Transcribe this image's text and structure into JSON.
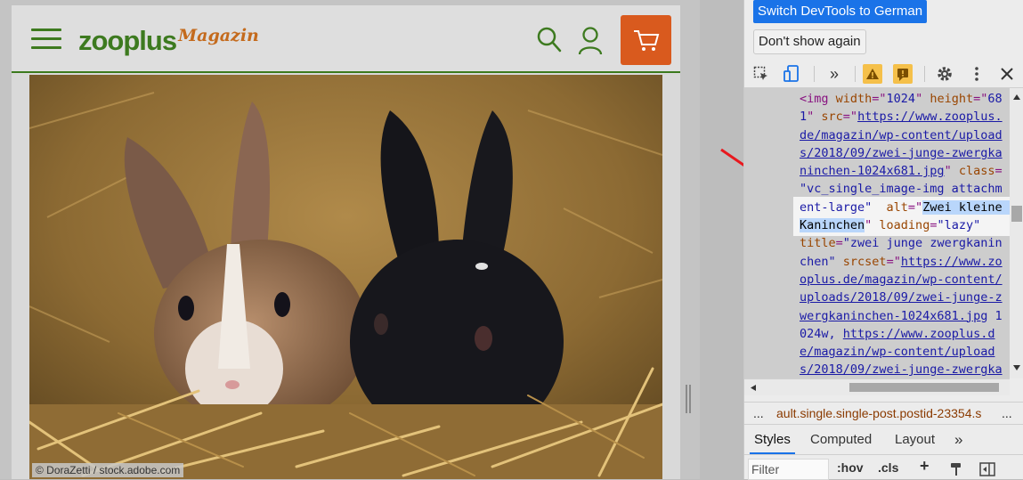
{
  "site": {
    "logo_text": "zooplus",
    "logo_magazin": "Magazin",
    "hero_credit": "© DoraZetti / stock.adobe.com"
  },
  "devtools": {
    "switch_lang_label": "Switch DevTools to German",
    "dont_show_label": "Don't show again",
    "code_lines": [
      [
        [
          "tag",
          "<img "
        ],
        [
          "attr",
          "width"
        ],
        [
          "tag",
          "=\""
        ],
        [
          "val",
          "1024"
        ],
        [
          "tag",
          "\" "
        ],
        [
          "attr",
          "height"
        ],
        [
          "tag",
          "=\""
        ],
        [
          "val",
          "68"
        ]
      ],
      [
        [
          "val",
          "1"
        ],
        [
          "tag",
          "\" "
        ],
        [
          "attr",
          "src"
        ],
        [
          "tag",
          "=\""
        ],
        [
          "link",
          "https://www.zooplus."
        ]
      ],
      [
        [
          "link",
          "de/magazin/wp-content/upload"
        ]
      ],
      [
        [
          "link",
          "s/2018/09/zwei-junge-zwergka"
        ]
      ],
      [
        [
          "link",
          "ninchen-1024x681.jpg"
        ],
        [
          "tag",
          "\" "
        ],
        [
          "attr",
          "class"
        ],
        [
          "tag",
          "="
        ]
      ],
      [
        [
          "val",
          "\"vc_single_image-img attachm"
        ]
      ],
      [
        [
          "val",
          "ent-large\" "
        ],
        [
          "attr",
          " alt"
        ],
        [
          "tag",
          "=\""
        ],
        [
          "sel",
          "Zwei kleine "
        ]
      ],
      [
        [
          "sel",
          "Kaninchen"
        ],
        [
          "tag",
          "\" "
        ],
        [
          "attr",
          "loading"
        ],
        [
          "tag",
          "="
        ],
        [
          "val",
          "\"lazy\""
        ]
      ],
      [
        [
          "attr",
          "title"
        ],
        [
          "tag",
          "="
        ],
        [
          "val",
          "\"zwei junge zwergkanin"
        ]
      ],
      [
        [
          "val",
          "chen\" "
        ],
        [
          "attr",
          "srcset"
        ],
        [
          "tag",
          "=\""
        ],
        [
          "link",
          "https://www.zo"
        ]
      ],
      [
        [
          "link",
          "oplus.de/magazin/wp-content/"
        ]
      ],
      [
        [
          "link",
          "uploads/2018/09/zwei-junge-z"
        ]
      ],
      [
        [
          "link",
          "wergkaninchen-1024x681.jpg"
        ],
        [
          "val",
          " 1"
        ]
      ],
      [
        [
          "val",
          "024w, "
        ],
        [
          "link",
          "https://www.zooplus.d"
        ]
      ],
      [
        [
          "link",
          "e/magazin/wp-content/upload"
        ]
      ],
      [
        [
          "link",
          "s/2018/09/zwei-junge-zwergka"
        ]
      ]
    ],
    "breadcrumb_dots": "...",
    "breadcrumb_text": "ault.single.single-post.postid-23354.s",
    "breadcrumb_more": "...",
    "tabs": {
      "styles": "Styles",
      "computed": "Computed",
      "layout": "Layout",
      "more": "»"
    },
    "filter_placeholder": "Filter",
    "hov_label": ":hov",
    "cls_label": ".cls",
    "plus_label": "+",
    "more_tools": "»",
    "accent": "#1a73e8"
  }
}
